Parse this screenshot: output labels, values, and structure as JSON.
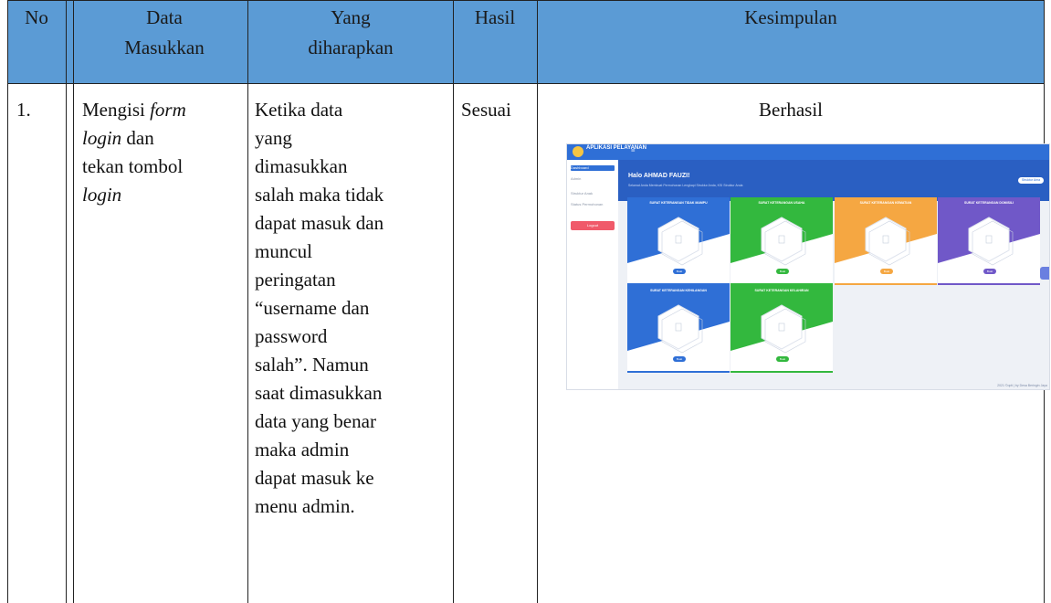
{
  "table": {
    "headers": {
      "no": "No",
      "data_masukkan": "Data Masukkan",
      "yang_diharapkan": "Yang diharapkan",
      "hasil": "Hasil",
      "kesimpulan": "Kesimpulan"
    },
    "rows": [
      {
        "no": "1.",
        "data_masukkan": "Mengisi form login dan tekan tombol login",
        "yang_diharapkan": "Ketika data yang dimasukkan salah maka tidak dapat masuk dan muncul peringatan “username dan password salah”. Namun saat dimasukkan data yang benar maka admin dapat masuk ke menu admin.",
        "hasil": "Sesuai",
        "kesimpulan": "Berhasil"
      }
    ],
    "header_bg": "#5b9bd5"
  },
  "screenshot": {
    "app_title": "APLIKASI PELAYANAN",
    "sidebar": [
      {
        "label": "Dashboard",
        "active": true
      },
      {
        "label": "Admin"
      },
      {
        "label": "Struktur Anak"
      },
      {
        "label": "Status Permohonan"
      }
    ],
    "logout_label": "Logout",
    "greeting": "Halo AHMAD FAUZI!",
    "greeting_sub": "Selamat Anda Membuat Permohonan Lengkapi Struktur Anda, KSI Struktur Anda",
    "header_button": "Struktur Ama",
    "cards": [
      {
        "title": "SURAT KETERANGAN TIDAK MAMPU",
        "color": "#2f6fd6",
        "button": "Buat"
      },
      {
        "title": "SURAT KETERANGAN USAHA",
        "color": "#33b83e",
        "button": "Buat"
      },
      {
        "title": "SURAT KETERANGAN KEMATIAN",
        "color": "#f5a742",
        "button": "Buat"
      },
      {
        "title": "SURAT KETERANGAN DOMISILI",
        "color": "#7058c8",
        "button": "Buat"
      },
      {
        "title": "SURAT KETERANGAN KEHILANGAN",
        "color": "#2f6fd6",
        "button": "Buat"
      },
      {
        "title": "SURAT KETERANGAN KELAHIRAN",
        "color": "#33b83e",
        "button": "Buat"
      }
    ],
    "footer": "2021 ©opti | by Desa Beringin Jaya"
  }
}
